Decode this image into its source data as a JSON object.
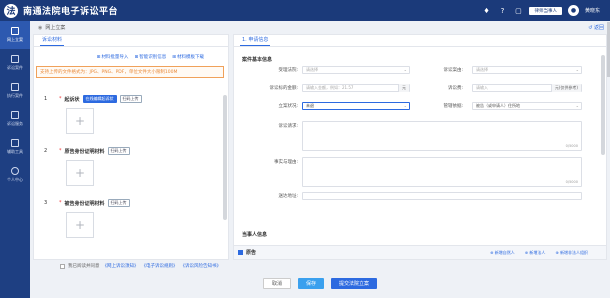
{
  "header": {
    "app_title": "南通法院电子诉讼平台",
    "role_label": "律师当事人",
    "user_name": "黄晓东",
    "logo_glyph": "法",
    "accent_color": "#1b3a7a"
  },
  "sidebar": {
    "items": [
      {
        "label": "网上立案",
        "icon": "file-icon",
        "active": true
      },
      {
        "label": "诉讼案件",
        "icon": "case-icon"
      },
      {
        "label": "执行案件",
        "icon": "execute-icon"
      },
      {
        "label": "诉讼服务",
        "icon": "service-icon"
      },
      {
        "label": "辅助工具",
        "icon": "tools-icon"
      },
      {
        "label": "个人中心",
        "icon": "user-icon"
      }
    ]
  },
  "breadcrumb": {
    "text": "网上立案",
    "back_label": "返回"
  },
  "left_panel": {
    "tab": "诉讼材料",
    "tools": [
      "材料批量导入",
      "智能识别信息",
      "材料模板下载"
    ],
    "notice": "支持上传的文件格式为：JPG、PNG、PDF，单位文件大小限制100M",
    "materials": [
      {
        "num": "1",
        "name": "起诉状",
        "btn1": "在线编辑起诉状",
        "btn2": "扫码上传"
      },
      {
        "num": "2",
        "name": "原告身份证明材料",
        "btn1": "",
        "btn2": "扫码上传"
      },
      {
        "num": "3",
        "name": "被告身份证明材料",
        "btn1": "",
        "btn2": "扫码上传"
      }
    ],
    "plus": "+"
  },
  "right_panel": {
    "tab": "1. 申请信息",
    "section_case": "案件基本信息",
    "fields": {
      "court_label": "受理法院:",
      "court_placeholder": "请选择",
      "case_type_label": "诉讼案由:",
      "case_type_placeholder": "请选择",
      "amount_label": "诉讼标的金额:",
      "amount_placeholder": "请输入金额，例如：21.57",
      "amount_unit": "元",
      "fee_label": "诉讼费:",
      "fee_placeholder": "请输入",
      "fee_suffix": "元(仅供参考)",
      "exec_label": "立案状况:",
      "exec_value": "未退",
      "jurisdiction_label": "管辖依据:",
      "jurisdiction_value": "被告（或申请人）住所地",
      "claim_label": "诉讼请求:",
      "claim_counter": "0/5000",
      "facts_label": "事实与理由:",
      "facts_counter": "0/5000",
      "address_label": "送达地址:"
    },
    "section_party": "当事人信息",
    "plaintiff_label": "原告",
    "party_actions": [
      "新增自然人",
      "新增法人",
      "新增非法人组织"
    ]
  },
  "agree": {
    "prefix": "我已阅读并同意",
    "links": [
      "《网上诉讼须知》",
      "《电子诉讼规则》",
      "《诉讼风险告知书》"
    ]
  },
  "footer": {
    "cancel": "取消",
    "save": "保存",
    "submit": "提交法院立案"
  }
}
